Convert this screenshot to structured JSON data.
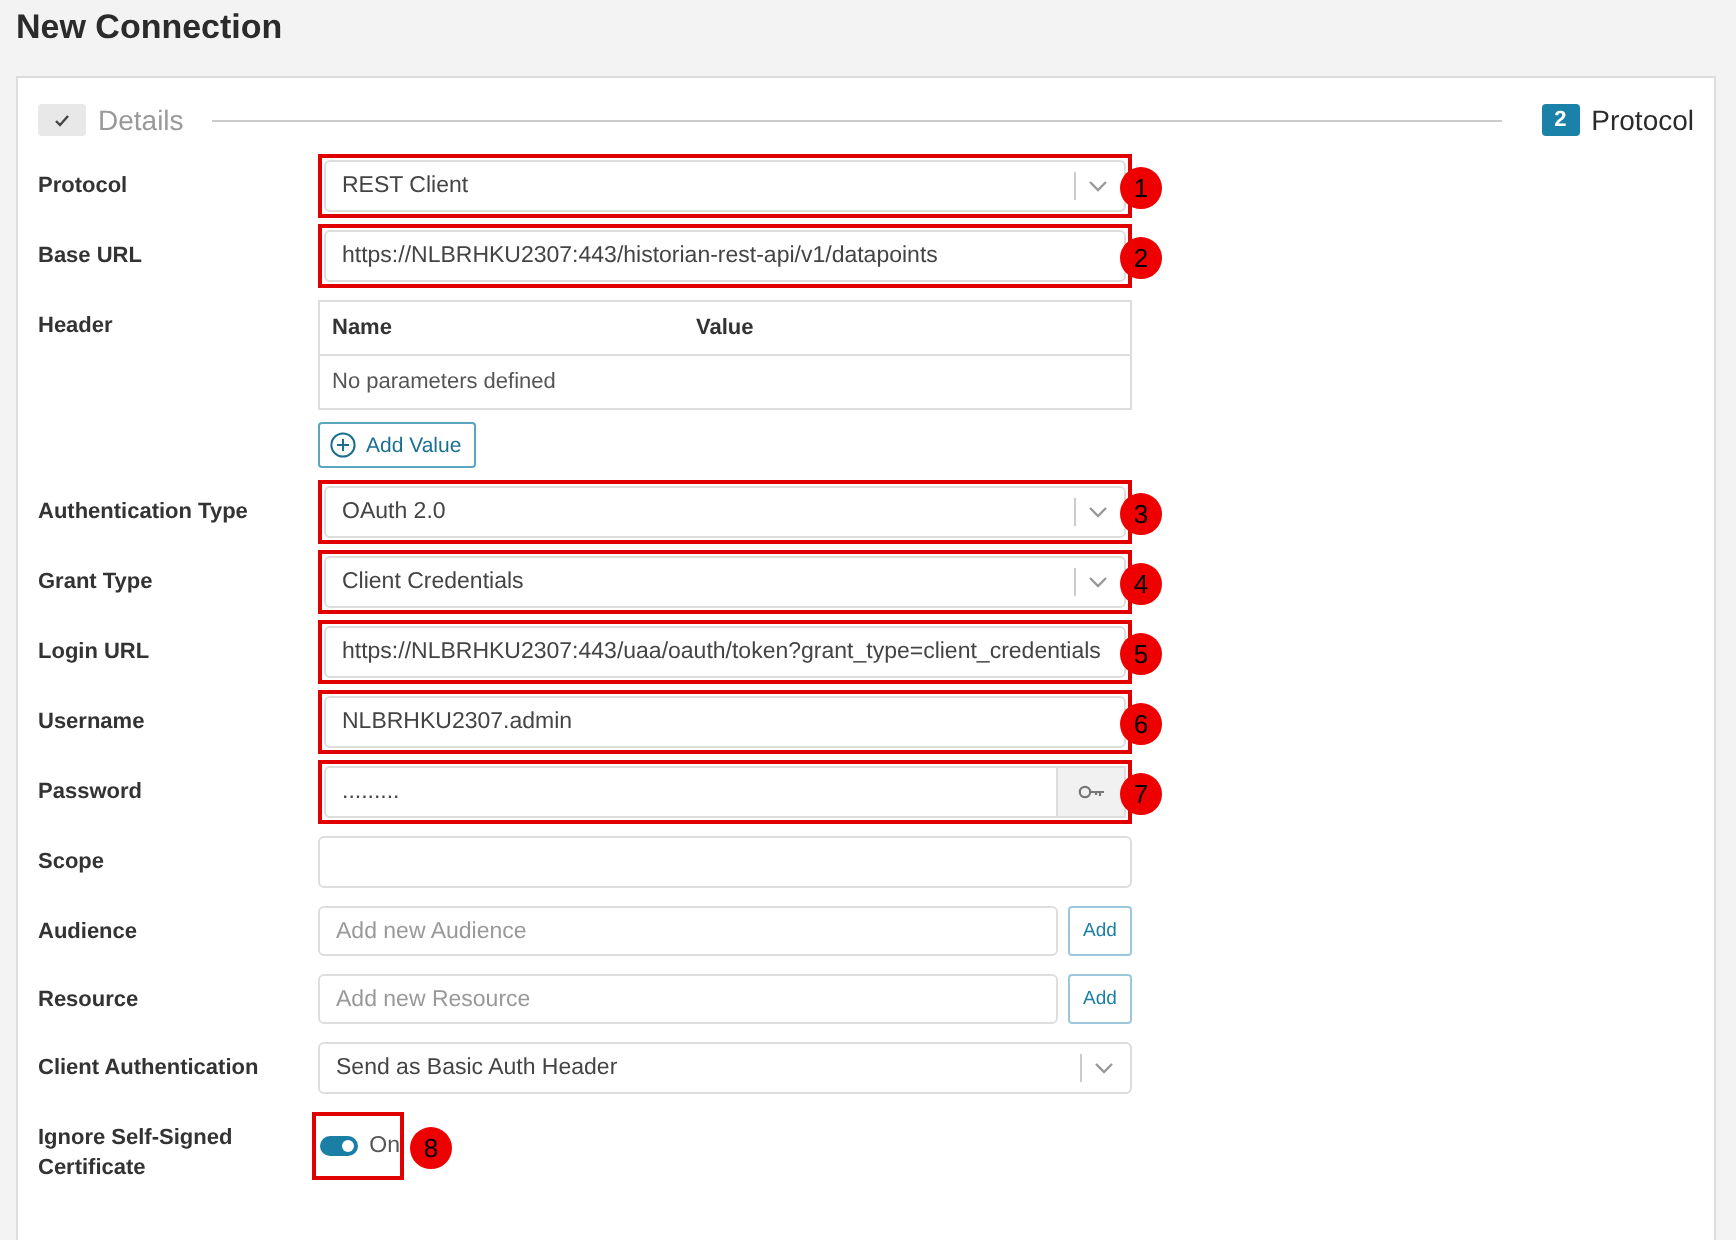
{
  "title": "New Connection",
  "steps": [
    {
      "label": "Details",
      "done": true,
      "active": false
    },
    {
      "label": "Protocol",
      "number": "2",
      "done": false,
      "active": true
    }
  ],
  "fields": [
    {
      "kind": "select",
      "label": "Protocol",
      "value": "REST Client",
      "callout": "1"
    },
    {
      "kind": "input",
      "label": "Base URL",
      "value": "https://NLBRHKU2307:443/historian-rest-api/v1/datapoints",
      "callout": "2"
    },
    {
      "kind": "table",
      "label": "Header",
      "columns": [
        "Name",
        "Value"
      ],
      "empty_text": "No parameters defined",
      "button": "Add Value"
    },
    {
      "kind": "select",
      "label": "Authentication Type",
      "value": "OAuth 2.0",
      "callout": "3"
    },
    {
      "kind": "select",
      "label": "Grant Type",
      "value": "Client Credentials",
      "callout": "4"
    },
    {
      "kind": "input",
      "label": "Login URL",
      "value": "https://NLBRHKU2307:443/uaa/oauth/token?grant_type=client_credentials",
      "callout": "5"
    },
    {
      "kind": "input",
      "label": "Username",
      "value": "NLBRHKU2307.admin",
      "callout": "6"
    },
    {
      "kind": "password",
      "label": "Password",
      "value": ".........",
      "callout": "7"
    },
    {
      "kind": "input",
      "label": "Scope"
    },
    {
      "kind": "add",
      "label": "Audience",
      "placeholder": "Add new Audience",
      "button": "Add"
    },
    {
      "kind": "add",
      "label": "Resource",
      "placeholder": "Add new Resource",
      "button": "Add"
    },
    {
      "kind": "select",
      "label": "Client Authentication",
      "value": "Send as Basic Auth Header"
    },
    {
      "kind": "toggle",
      "label": "Ignore Self-Signed Certificate",
      "on": true,
      "text": "On",
      "callout": "8"
    }
  ]
}
